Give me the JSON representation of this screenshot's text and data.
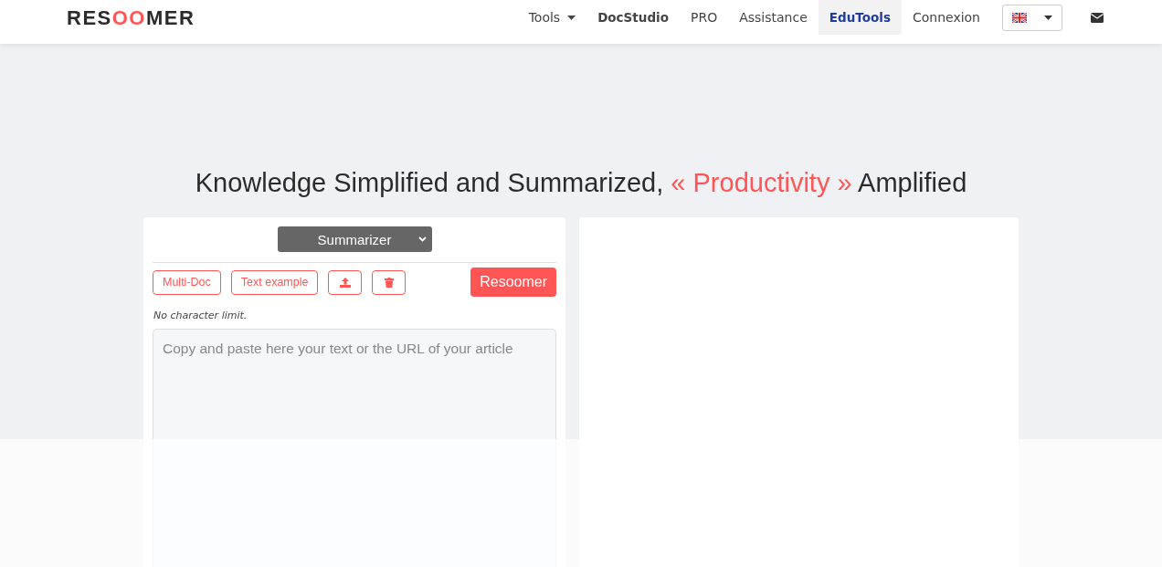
{
  "logo": {
    "parts": [
      {
        "text": "RES",
        "accent": false
      },
      {
        "text": "OO",
        "accent": true
      },
      {
        "text": "MER",
        "accent": false
      }
    ]
  },
  "nav": [
    {
      "label": "Tools",
      "kind": "dropdown",
      "selected": false
    },
    {
      "label": "DocStudio",
      "kind": "bold",
      "selected": false
    },
    {
      "label": "PRO",
      "kind": "plain",
      "selected": false
    },
    {
      "label": "Assistance",
      "kind": "plain",
      "selected": false
    },
    {
      "label": "EduTools",
      "kind": "bold",
      "selected": true
    },
    {
      "label": "Connexion",
      "kind": "plain",
      "selected": false
    }
  ],
  "headline": {
    "parts": [
      {
        "text": "Knowledge Simplified and Summarized, ",
        "accent": false
      },
      {
        "text": "« Productivity »",
        "accent": true
      },
      {
        "text": " Amplified",
        "accent": false
      }
    ]
  },
  "mode_select": {
    "value": "Summarizer"
  },
  "toolbar": [
    {
      "kind": "text",
      "label": "Multi-Doc"
    },
    {
      "kind": "text",
      "label": "Text example"
    },
    {
      "kind": "upload"
    },
    {
      "kind": "delete"
    }
  ],
  "submit": {
    "label": "Resoomer"
  },
  "limit_note": "No character limit.",
  "input": {
    "placeholder": "Copy and paste here your text or the URL of your article"
  }
}
